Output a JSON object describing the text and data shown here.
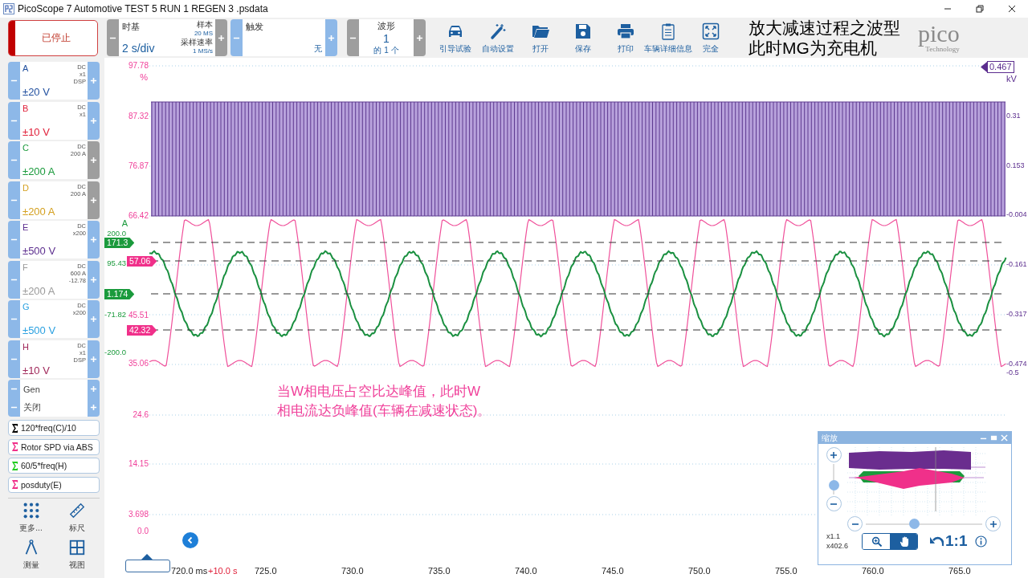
{
  "window": {
    "title": "PicoScope 7 Automotive TEST 5 RUN 1 REGEN 3 .psdata"
  },
  "toolbar": {
    "run_button": {
      "label": "已停止",
      "running": false
    },
    "timebase": {
      "label": "时基",
      "value": "2 s/div",
      "samples_label": "样本",
      "samples": "20 MS",
      "rate_label": "采样速率",
      "rate": "1 MS/s"
    },
    "trigger": {
      "label": "触发",
      "mode": "无"
    },
    "waveforms": {
      "label": "波形",
      "value": "1",
      "count": "的 1 个"
    },
    "tools": [
      {
        "kind": "car",
        "label": "引导试验"
      },
      {
        "kind": "wand",
        "label": "自动设置"
      },
      {
        "kind": "folder",
        "label": "打开"
      },
      {
        "kind": "save",
        "label": "保存"
      },
      {
        "kind": "print",
        "label": "打印"
      },
      {
        "kind": "clipboard",
        "label": "车辆详细信息"
      },
      {
        "kind": "expand",
        "label": "完全"
      }
    ],
    "caption": [
      "放大减速过程之波型",
      "此时MG为充电机"
    ],
    "logo": {
      "name": "pico",
      "tagline": "Technology"
    }
  },
  "channels": [
    {
      "name": "A",
      "color": "#1f4e9e",
      "settings": [
        "DC",
        "x1",
        "DSP"
      ],
      "range": "±20 V",
      "plus_enabled": true
    },
    {
      "name": "B",
      "color": "#e0203a",
      "settings": [
        "DC",
        "x1"
      ],
      "range": "±10 V",
      "plus_enabled": true
    },
    {
      "name": "C",
      "color": "#1a9a3c",
      "settings": [
        "DC",
        "200 A"
      ],
      "range": "±200 A",
      "plus_enabled": false
    },
    {
      "name": "D",
      "color": "#d4a020",
      "settings": [
        "DC",
        "200 A"
      ],
      "range": "±200 A",
      "plus_enabled": false
    },
    {
      "name": "E",
      "color": "#5b2d8e",
      "settings": [
        "DC",
        "x200"
      ],
      "range": "±500 V",
      "plus_enabled": true
    },
    {
      "name": "F",
      "color": "#9a9a9a",
      "settings": [
        "DC",
        "600 A",
        "-12.78"
      ],
      "range": "±200 A",
      "plus_enabled": true
    },
    {
      "name": "G",
      "color": "#2aa0e0",
      "settings": [
        "DC",
        "x200"
      ],
      "range": "±500 V",
      "plus_enabled": true
    },
    {
      "name": "H",
      "color": "#a0285a",
      "settings": [
        "DC",
        "x1",
        "DSP"
      ],
      "range": "±10 V",
      "plus_enabled": true
    }
  ],
  "generator": [
    {
      "label": "Gen"
    },
    {
      "label": "关闭"
    }
  ],
  "math_channels": [
    {
      "label": "120*freq(C)/10",
      "color": "#000000"
    },
    {
      "label": "Rotor SPD via ABS",
      "color": "#f0308a"
    },
    {
      "label": "60/5*freq(H)",
      "color": "#22cc22"
    },
    {
      "label": "posduty(E)",
      "color": "#f0308a"
    }
  ],
  "bottom_tools": [
    {
      "kind": "dots",
      "label": "更多..."
    },
    {
      "kind": "ruler",
      "label": "标尺"
    },
    {
      "kind": "compass",
      "label": "测量"
    },
    {
      "kind": "grid",
      "label": "视图"
    }
  ],
  "plot": {
    "percent_axis": {
      "unit": "%",
      "ticks": [
        "97.78",
        "87.32",
        "76.87",
        "66.42",
        "45.51",
        "35.06",
        "24.6",
        "14.15",
        "3.698",
        "0.0"
      ]
    },
    "current_axis": {
      "unit": "A",
      "ticks": [
        "200.0",
        "95.43",
        "-71.82",
        "-200.0"
      ]
    },
    "markers": [
      {
        "value": "171.3",
        "color": "#1a9a3c"
      },
      {
        "value": "57.06",
        "color": "#f0308a"
      },
      {
        "value": "1.174",
        "color": "#1a9a3c"
      },
      {
        "value": "42.32",
        "color": "#f0308a"
      }
    ],
    "voltage_axis": {
      "marker": "0.467",
      "unit": "kV",
      "ticks": [
        "0.31",
        "0.153",
        "-0.004",
        "-0.161",
        "-0.317",
        "-0.474",
        "-0.5"
      ]
    },
    "note": [
      "当W相电压占空比达峰值，此时W",
      "相电流达负峰值(车辆在减速状态)。"
    ],
    "time_axis": {
      "start": "720.0 ms",
      "offset": "+10.0 s",
      "ticks": [
        "725.0",
        "730.0",
        "735.0",
        "740.0",
        "745.0",
        "750.0",
        "755.0",
        "760.0",
        "765.0"
      ]
    }
  },
  "zoom_panel": {
    "title": "缩放",
    "vertical_zoom": {
      "level": 0.2
    },
    "horizontal_zoom": {
      "level": 0.41
    },
    "scale_x": "x1.1",
    "scale_y": "x402.6",
    "modes": [
      {
        "kind": "zoom",
        "selected": false
      },
      {
        "kind": "pan",
        "selected": true
      }
    ],
    "reset_label": "1:1"
  }
}
